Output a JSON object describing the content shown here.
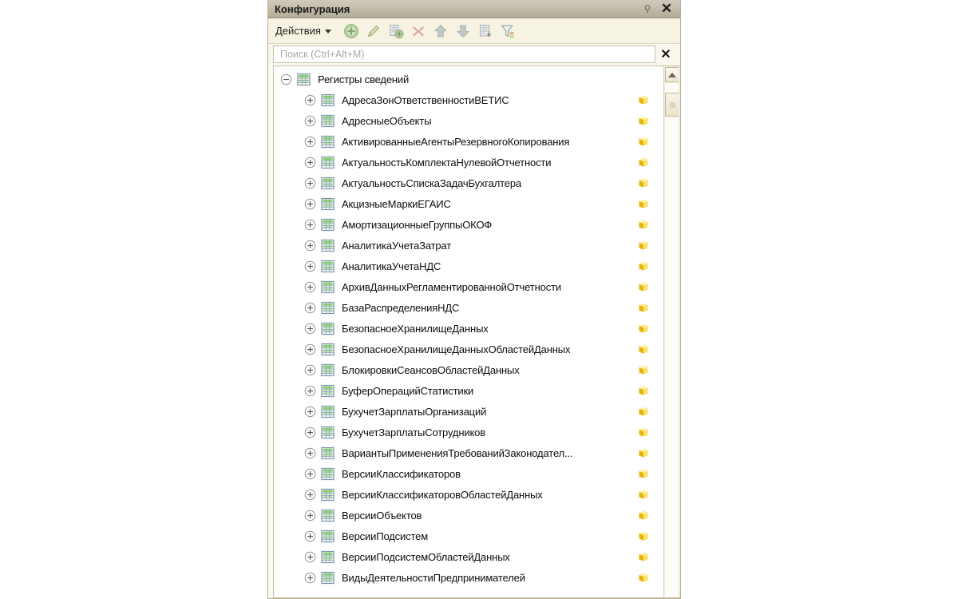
{
  "window": {
    "title": "Конфигурация",
    "pin_glyph": "⚲",
    "close_glyph": "✕"
  },
  "toolbar": {
    "actions_label": "Действия",
    "icons": [
      {
        "name": "add-icon",
        "title": "Добавить"
      },
      {
        "name": "edit-pencil-icon",
        "title": "Изменить"
      },
      {
        "name": "copy-add-icon",
        "title": "Скопировать"
      },
      {
        "name": "delete-x-icon",
        "title": "Удалить"
      },
      {
        "name": "move-up-icon",
        "title": "Переместить вверх"
      },
      {
        "name": "move-down-icon",
        "title": "Переместить вниз"
      },
      {
        "name": "sort-list-icon",
        "title": "Сортировать"
      },
      {
        "name": "filter-funnel-icon",
        "title": "Отбор"
      }
    ]
  },
  "search": {
    "value": "",
    "placeholder": "Поиск (Ctrl+Alt+M)",
    "clear_glyph": "✕"
  },
  "tree": {
    "root": {
      "label": "Регистры сведений",
      "expanded": true,
      "expander_glyph": "−"
    },
    "items": [
      {
        "label": "АдресаЗонОтветственностиВЕТИС"
      },
      {
        "label": "АдресныеОбъекты"
      },
      {
        "label": "АктивированныеАгентыРезервногоКопирования"
      },
      {
        "label": "АктуальностьКомплектаНулевойОтчетности"
      },
      {
        "label": "АктуальностьСпискаЗадачБухгалтера"
      },
      {
        "label": "АкцизныеМаркиЕГАИС"
      },
      {
        "label": "АмортизационныеГруппыОКОФ"
      },
      {
        "label": "АналитикаУчетаЗатрат"
      },
      {
        "label": "АналитикаУчетаНДС"
      },
      {
        "label": "АрхивДанныхРегламентированнойОтчетности"
      },
      {
        "label": "БазаРаспределенияНДС"
      },
      {
        "label": "БезопасноеХранилищеДанных"
      },
      {
        "label": "БезопасноеХранилищеДанныхОбластейДанных"
      },
      {
        "label": "БлокировкиСеансовОбластейДанных"
      },
      {
        "label": "БуферОперацийСтатистики"
      },
      {
        "label": "БухучетЗарплатыОрганизаций"
      },
      {
        "label": "БухучетЗарплатыСотрудников"
      },
      {
        "label": "ВариантыПримененияТребованийЗаконодател..."
      },
      {
        "label": "ВерсииКлассификаторов"
      },
      {
        "label": "ВерсииКлассификаторовОбластейДанных"
      },
      {
        "label": "ВерсииОбъектов"
      },
      {
        "label": "ВерсииПодсистем"
      },
      {
        "label": "ВерсииПодсистемОбластейДанных"
      },
      {
        "label": "ВидыДеятельностиПредпринимателей"
      }
    ],
    "child_expander_glyph": "+"
  },
  "scrollbar": {
    "up_label": "Прокрутить вверх"
  },
  "colors": {
    "titlebar": "#c3bdac",
    "toolbar": "#f7f3e2",
    "window_bg": "#fbfaf2",
    "tree_bg": "#ffffff",
    "border": "#b9ae8e",
    "package_yellow": "#f5d130",
    "register_green": "#7fd04a"
  }
}
